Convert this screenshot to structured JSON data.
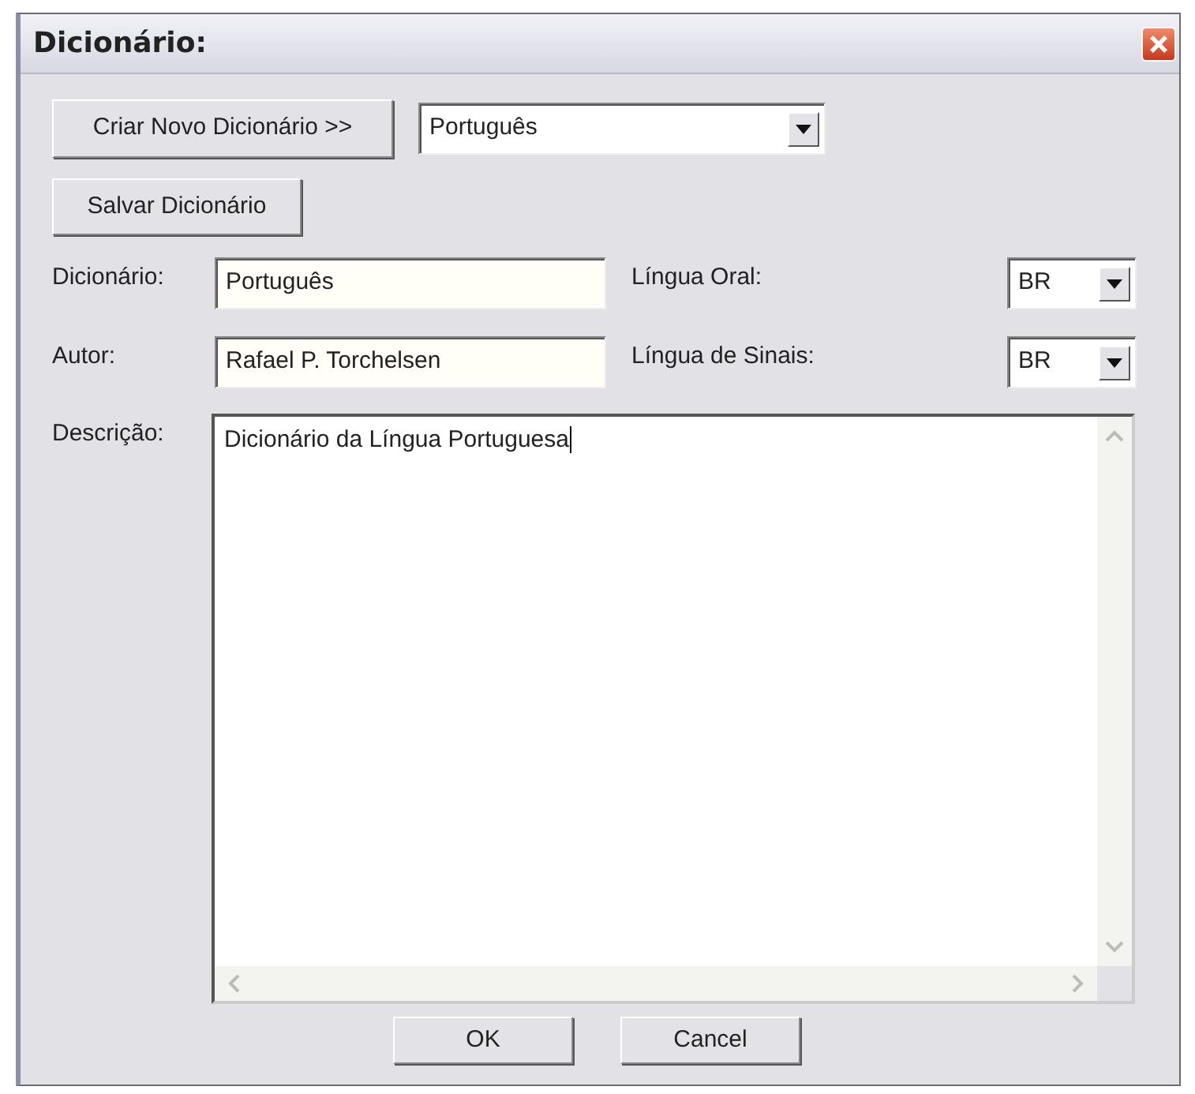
{
  "window": {
    "title": "Dicionário:"
  },
  "toolbar": {
    "create_button": "Criar Novo Dicionário >>",
    "dictionary_select": "Português",
    "save_button": "Salvar Dicionário"
  },
  "fields": [
    {
      "label": "Dicionário:",
      "value": "Português",
      "side_label": "Língua Oral:",
      "side_value": "BR"
    },
    {
      "label": "Autor:",
      "value": "Rafael P. Torchelsen",
      "side_label": "Língua de Sinais:",
      "side_value": "BR"
    }
  ],
  "description": {
    "label": "Descrição:",
    "value": "Dicionário da Língua Portuguesa"
  },
  "buttons": [
    "OK",
    "Cancel"
  ]
}
